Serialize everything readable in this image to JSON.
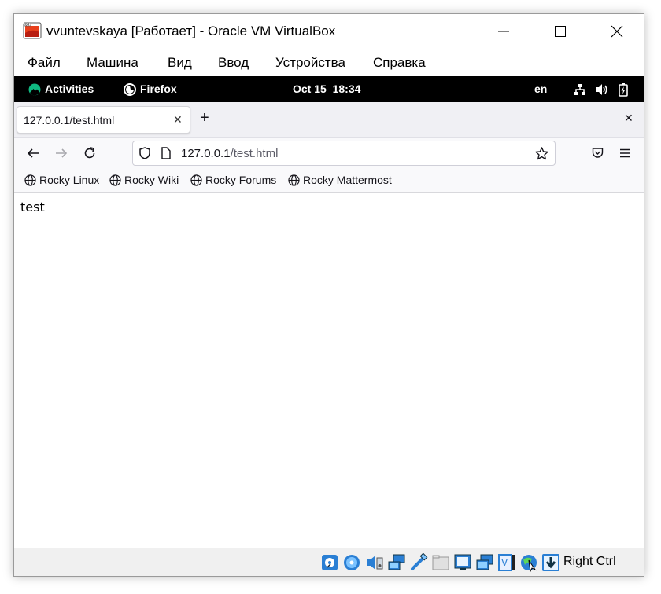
{
  "window": {
    "title": "vvuntevskaya [Работает] - Oracle VM VirtualBox",
    "app_icon": "virtualbox-vm-icon",
    "controls": [
      "minimize-icon",
      "maximize-icon",
      "close-icon"
    ]
  },
  "menu": {
    "items": [
      "Файл",
      "Машина",
      "Вид",
      "Ввод",
      "Устройства",
      "Справка"
    ]
  },
  "gnome_bar": {
    "activities": "Activities",
    "app": "Firefox",
    "clock": "Oct 15  18:34",
    "lang": "en",
    "tray_icons": [
      "network-icon",
      "volume-icon",
      "battery-icon"
    ]
  },
  "tabs": [
    {
      "title": "127.0.0.1/test.html",
      "active": true
    }
  ],
  "tab_strip": {
    "new_tab": "+",
    "close_window": "✕",
    "tab_close": "✕"
  },
  "nav": {
    "url_host": "127.0.0.1",
    "url_path": "/test.html",
    "icons": [
      "back-icon",
      "forward-icon",
      "reload-icon",
      "shield-icon",
      "page-icon",
      "star-icon",
      "pocket-icon",
      "menu-icon"
    ]
  },
  "bookmarks": [
    "Rocky Linux",
    "Rocky Wiki",
    "Rocky Forums",
    "Rocky Mattermost"
  ],
  "page": {
    "body_text": "test"
  },
  "statusbar": {
    "host_key": "Right Ctrl",
    "icons": [
      "hard-disk-icon",
      "optical-disk-icon",
      "audio-icon",
      "network-icon",
      "usb-icon",
      "shared-folders-icon",
      "display-icon",
      "video-capture-icon",
      "recording-icon",
      "cpu-icon",
      "mouse-integration-icon",
      "keyboard-icon"
    ]
  },
  "colors": {
    "gnome_bar": "#000000",
    "tab_strip": "#f0f0f4",
    "nav_bar": "#f9f9fb",
    "status_blue": "#2a7fd4"
  }
}
